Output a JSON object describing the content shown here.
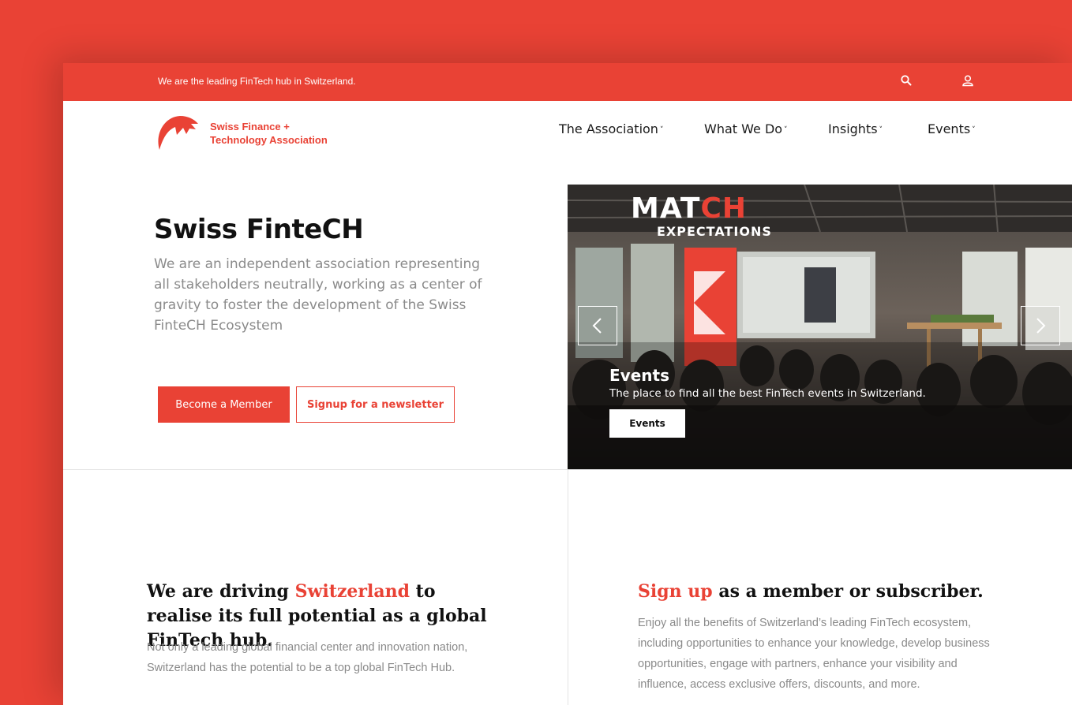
{
  "topbar": {
    "tagline": "We are the leading FinTech hub in Switzerland.",
    "icons": [
      "search-icon",
      "user-icon"
    ]
  },
  "logo": {
    "line1": "Swiss Finance +",
    "line2": "Technology Association"
  },
  "nav": {
    "items": [
      {
        "label": "The Association",
        "has_dropdown": true
      },
      {
        "label": "What We Do",
        "has_dropdown": true
      },
      {
        "label": "Insights",
        "has_dropdown": true
      },
      {
        "label": "Events",
        "has_dropdown": true
      }
    ],
    "chevron": "˅"
  },
  "hero": {
    "title": "Swiss FinteCH",
    "text": "We are an independent association representing all stakeholders neutrally, working as a center of gravity to foster the development of the Swiss FinteCH Ecosystem",
    "primary_button": "Become a Member",
    "secondary_button": "Signup for a newsletter"
  },
  "slider": {
    "banner_match_a": "MAT",
    "banner_match_b": "CH",
    "banner_expectations": "EXPECTATIONS",
    "caption_title": "Events",
    "caption_text": "The place to find all the best FinTech events in Switzerland.",
    "button_label": "Events"
  },
  "section_left": {
    "heading_pre": "We are driving ",
    "heading_accent": "Switzerland",
    "heading_post": " to realise its full potential as a global FinTech hub.",
    "text": "Not only a leading global financial center and innovation nation, Switzerland has the potential to be a top global FinTech Hub."
  },
  "section_right": {
    "heading_accent": "Sign up",
    "heading_post": " as a member or subscriber.",
    "text": "Enjoy all the benefits of Switzerland’s leading FinTech ecosystem, including opportunities to enhance your knowledge, develop business opportunities, engage with partners, enhance your visibility and influence, access exclusive offers, discounts, and more."
  },
  "colors": {
    "brand_red": "#e94235",
    "text_dark": "#111111",
    "text_muted": "#8a8a8a"
  }
}
